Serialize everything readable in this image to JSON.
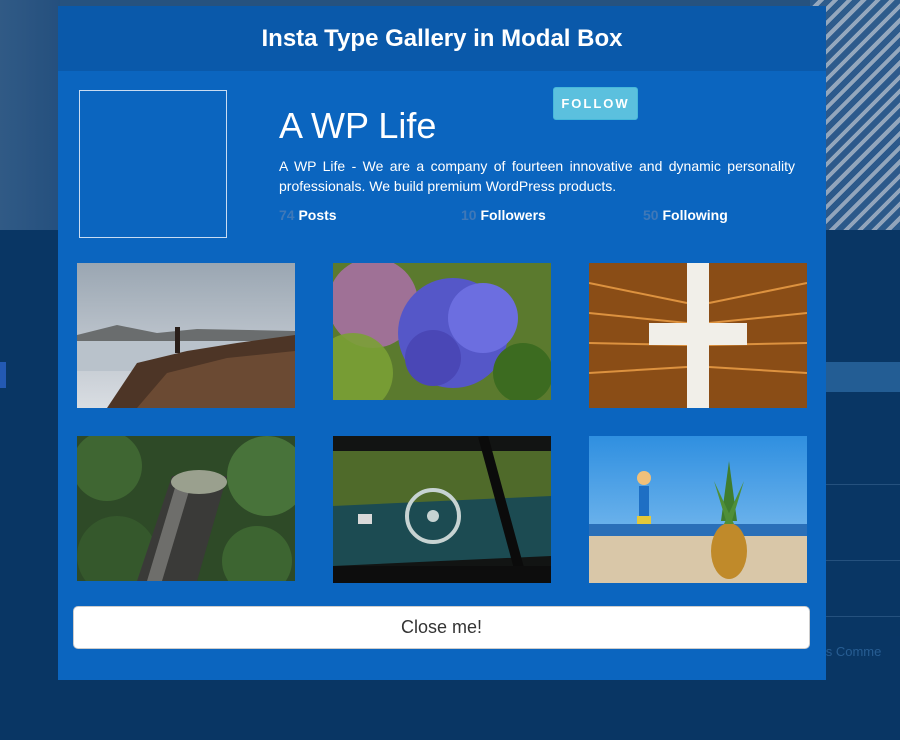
{
  "background": {
    "side_text": "ess Comme"
  },
  "modal": {
    "title": "Insta Type Gallery in Modal Box",
    "follow_label": "FOLLOW",
    "profile": {
      "name": "A WP Life",
      "description": "A WP Life - We are a company of fourteen innovative and dynamic personality professionals. We build premium WordPress products."
    },
    "stats": [
      {
        "count": "74",
        "label": "Posts"
      },
      {
        "count": "10",
        "label": "Followers"
      },
      {
        "count": "50",
        "label": "Following"
      }
    ],
    "gallery": [
      {
        "name": "lake-shore-photo"
      },
      {
        "name": "hydrangea-flower-photo"
      },
      {
        "name": "skyscrapers-photo"
      },
      {
        "name": "forest-tunnel-photo"
      },
      {
        "name": "vintage-car-interior-photo"
      },
      {
        "name": "beach-pineapple-photo"
      }
    ],
    "close_label": "Close me!"
  },
  "colors": {
    "modal_bg": "#0b65bf",
    "header_bg": "#0a59aa",
    "follow_bg": "#5bc0de",
    "page_bg": "#0a3a6b"
  }
}
